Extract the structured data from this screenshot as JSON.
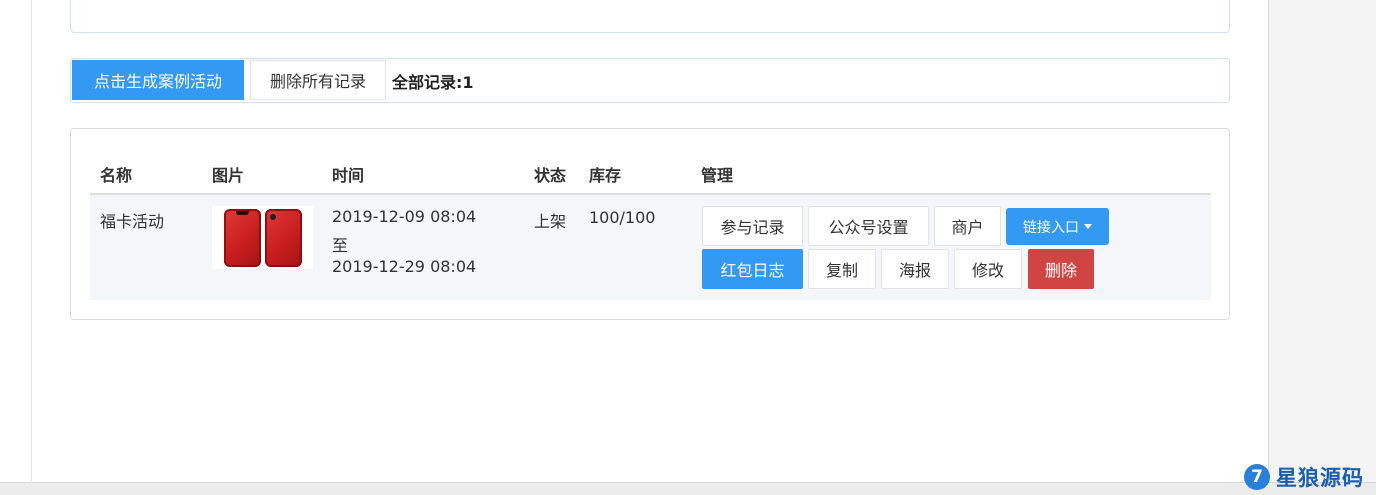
{
  "actions": {
    "generate_label": "点击生成案例活动",
    "delete_all_label": "删除所有记录",
    "total_records": "全部记录:1"
  },
  "table": {
    "headers": [
      "名称",
      "图片",
      "时间",
      "状态",
      "库存",
      "管理"
    ],
    "rows": [
      {
        "name": "福卡活动",
        "time_start": "2019-12-09 08:04",
        "time_sep": "至",
        "time_end": "2019-12-29 08:04",
        "status": "上架",
        "stock": "100/100",
        "image_color": "#c81e1e",
        "buttons": {
          "records": "参与记录",
          "wechat_settings": "公众号设置",
          "merchant": "商户",
          "link_entry": "链接入口",
          "redpacket_log": "红包日志",
          "copy": "复制",
          "poster": "海报",
          "edit": "修改",
          "delete": "删除"
        }
      }
    ]
  },
  "colors": {
    "primary": "#3399f3",
    "danger": "#d04444"
  },
  "watermark": {
    "symbol": "7",
    "text": "星狼源码"
  }
}
